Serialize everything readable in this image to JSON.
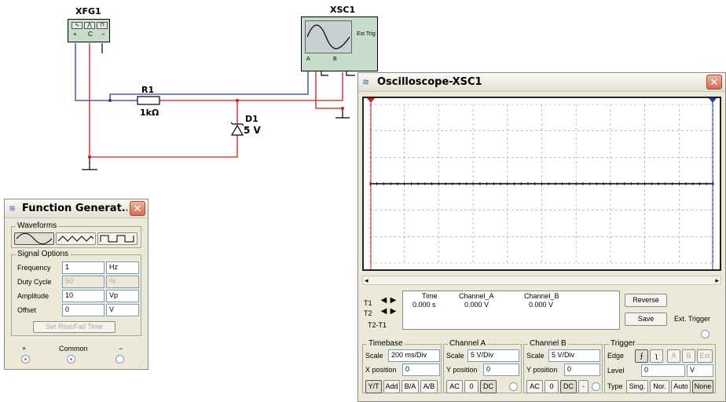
{
  "schematic": {
    "xfg_label": "XFG1",
    "xsc_label": "XSC1",
    "r1_label": "R1",
    "r1_value": "1kΩ",
    "d1_label": "D1",
    "d1_value": "5 V",
    "xfg_plus": "+",
    "xfg_common": "C",
    "xfg_minus": "−",
    "xsc_a": "A",
    "xsc_b": "B",
    "xsc_ext_trig": "Ext Trig",
    "wire_blue": "#2b3aa6",
    "wire_red": "#d41a1a"
  },
  "function_generator": {
    "title": "Function Generat...",
    "waveforms_title": "Waveforms",
    "signal_options_title": "Signal Options",
    "rows": [
      {
        "label": "Frequency",
        "value": "1",
        "unit": "Hz",
        "disabled": false
      },
      {
        "label": "Duty Cycle",
        "value": "50",
        "unit": "%",
        "disabled": true
      },
      {
        "label": "Amplitude",
        "value": "10",
        "unit": "Vp",
        "disabled": false
      },
      {
        "label": "Offset",
        "value": "0",
        "unit": "V",
        "disabled": false
      }
    ],
    "rise_fall_button": "Set Rise/Fall Time",
    "terminal_plus": "+",
    "terminal_common": "Common",
    "terminal_minus": "−"
  },
  "oscilloscope": {
    "title": "Oscilloscope-XSC1",
    "screen_bg": "#ffffff",
    "trace_color": "#000000",
    "cursor_t1_color": "#d41a1a",
    "cursor_t2_color": "#2b3aa6",
    "readout": {
      "t1_label": "T1",
      "t2_label": "T2",
      "t2t1_label": "T2-T1",
      "col_time": "Time",
      "col_a": "Channel_A",
      "col_b": "Channel_B",
      "t1_time": "0.000 s",
      "t1_a": "0.000 V",
      "t1_b": "0.000 V"
    },
    "reverse_button": "Reverse",
    "save_button": "Save",
    "ext_trigger_label": "Ext. Trigger",
    "timebase": {
      "title": "Timebase",
      "scale_label": "Scale",
      "scale_value": "200 ms/Div",
      "xpos_label": "X position",
      "xpos_value": "0",
      "buttons": [
        "Y/T",
        "Add",
        "B/A",
        "A/B"
      ]
    },
    "channel_a": {
      "title": "Channel A",
      "scale_label": "Scale",
      "scale_value": "5  V/Div",
      "ypos_label": "Y position",
      "ypos_value": "0",
      "buttons": [
        "AC",
        "0",
        "DC"
      ]
    },
    "channel_b": {
      "title": "Channel B",
      "scale_label": "Scale",
      "scale_value": "5  V/Div",
      "ypos_label": "Y position",
      "ypos_value": "0",
      "buttons": [
        "AC",
        "0",
        "DC",
        "-"
      ]
    },
    "trigger": {
      "title": "Trigger",
      "edge_label": "Edge",
      "edge_buttons": [
        "A",
        "B",
        "Ext"
      ],
      "level_label": "Level",
      "level_value": "0",
      "level_unit": "V",
      "type_label": "Type",
      "type_buttons": [
        "Sing.",
        "Nor.",
        "Auto",
        "None"
      ]
    }
  }
}
